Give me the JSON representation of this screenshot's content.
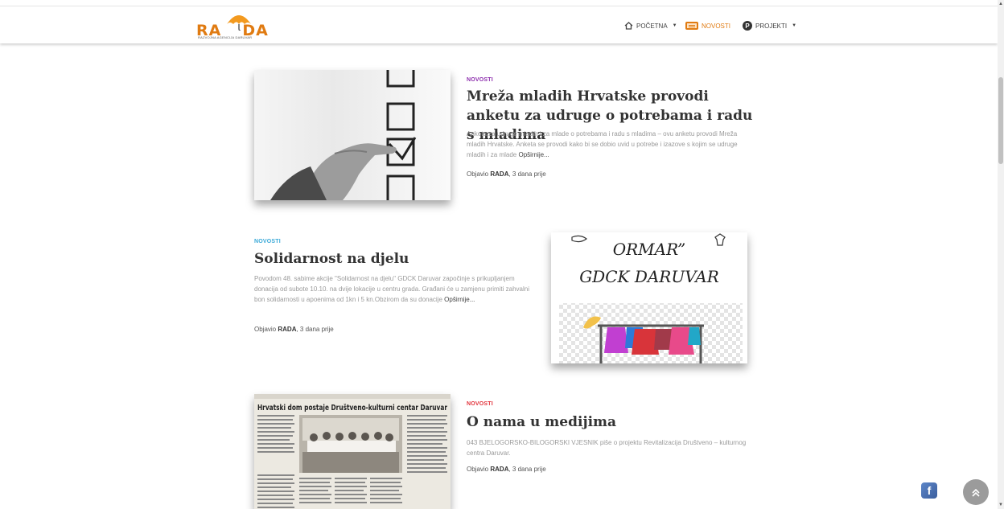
{
  "logo": {
    "text_left": "RA",
    "text_right": "DA",
    "subtitle": "RAZVOJNA AGENCIJA DARUVAR"
  },
  "nav": {
    "home": {
      "label": "POČETNA",
      "icon": "home-icon"
    },
    "news": {
      "label": "NOVOSTI",
      "icon": "newspaper-icon"
    },
    "projects": {
      "label": "PROJEKTI",
      "icon": "p-circle-icon"
    }
  },
  "articles": [
    {
      "category": "NOVOSTI",
      "category_color": "#8e2fae",
      "title": "Mreža mladih Hrvatske provodi anketu za udruge o potrebama i radu s mladima",
      "excerpt": "Anketa za udruge mladih i za mlade o potrebama i radu s mladima – ovu anketu provodi Mreža mladih Hrvatske. Anketa se provodi kako bi se dobio uvid u potrebe i izazove s kojim se udruge mladih i za mlade",
      "more": "Opširnije...",
      "meta_prefix": "Objavio",
      "author": "RADA",
      "time": ", 3 dana prije"
    },
    {
      "category": "NOVOSTI",
      "category_color": "#3aa9d8",
      "title": "Solidarnost na djelu",
      "excerpt": "Povodom 48. sabime akcije \"Solidarnost na djelu\" GDCK Daruvar započinje s prikupljanjem donacija od subote 10.10. na dvije lokacije u centru grada. Građani će u zamjenu primiti zahvalni bon solidarnosti u apoenima od 1kn i 5 kn.Obzirom da su donacije",
      "more": "Opširnije...",
      "meta_prefix": "Objavio",
      "author": "RADA",
      "time": ", 3 dana prije",
      "image_text_1": "ORMAR”",
      "image_text_2": "GDCK DARUVAR"
    },
    {
      "category": "NOVOSTI",
      "category_color": "#e2343c",
      "title": "O nama u medijima",
      "excerpt": "043 BJELOGORSKO-BILOGORSKI VJESNIK piše o projektu Revitalizacija Društveno – kulturnog centra Daruvar.",
      "meta_prefix": "Objavio",
      "author": "RADA",
      "time": ", 3 dana prije",
      "image_text_1": "Hrvatski dom postaje Društveno-kulturni centar Daruvar"
    }
  ],
  "floating": {
    "facebook_icon": "facebook-icon",
    "totop_icon": "chevron-up-icon"
  }
}
